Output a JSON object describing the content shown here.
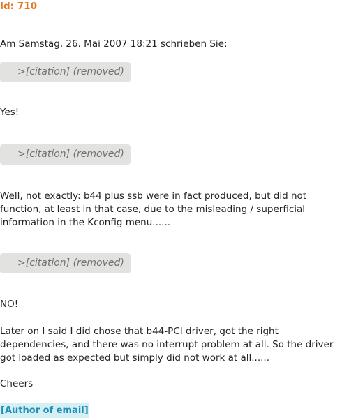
{
  "header": {
    "id_label": "Id: 710"
  },
  "message": {
    "intro": "Am Samstag, 26. Mai 2007 18:21 schrieben Sie:",
    "citation_label": ">[citation] (removed)",
    "reply_1": "Yes!",
    "reply_2": "Well, not exactly: b44 plus ssb were in fact produced, but did not function, at least in that case, due to the misleading / superficial information in the Kconfig menu......",
    "reply_3": "NO!",
    "reply_4": "Later on I said I did chose that b44-PCI driver, got the right dependencies, and there was no interrupt problem at all. So the driver got loaded as expected but simply did not work at all......",
    "sign_off": "Cheers"
  },
  "footer": {
    "author_label": "[Author of email]"
  },
  "colors": {
    "id_color": "#e07b24",
    "citation_bg": "#e2e3e0",
    "citation_text": "#6f7370",
    "author_bg": "#d4f0f4",
    "author_text": "#1f8fb8"
  }
}
